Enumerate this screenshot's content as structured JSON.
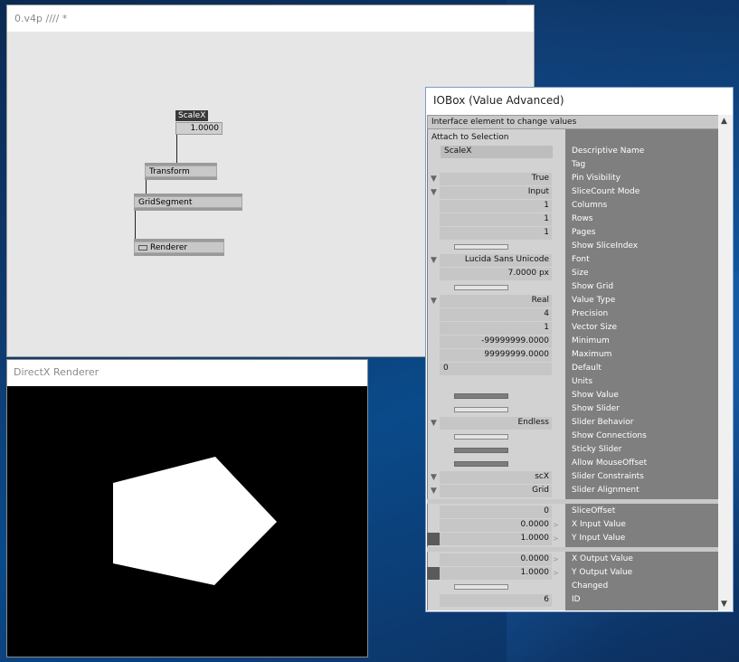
{
  "patch": {
    "title": "0.v4p //// *",
    "scalex_node": "ScaleX",
    "scalex_value": "1.0000",
    "transform_node": "Transform",
    "gridsegment_node": "GridSegment",
    "renderer_node": "Renderer"
  },
  "renderer": {
    "title": "DirectX Renderer"
  },
  "iobox": {
    "title": "IOBox (Value Advanced)",
    "description": "Interface element to change values",
    "attach_label": "Attach to Selection",
    "descriptive_name_value": "ScaleX",
    "rows": [
      {
        "label": "Descriptive Name",
        "value": "",
        "kind": "blank"
      },
      {
        "label": "Tag",
        "value": "",
        "kind": "blank"
      },
      {
        "label": "Pin Visibility",
        "value": "True",
        "kind": "enum"
      },
      {
        "label": "SliceCount Mode",
        "value": "Input",
        "kind": "enum"
      },
      {
        "label": "Columns",
        "value": "1",
        "kind": "num"
      },
      {
        "label": "Rows",
        "value": "1",
        "kind": "num"
      },
      {
        "label": "Pages",
        "value": "1",
        "kind": "num"
      },
      {
        "label": "Show SliceIndex",
        "value": "",
        "kind": "toggle-off"
      },
      {
        "label": "Font",
        "value": "Lucida Sans Unicode",
        "kind": "enum"
      },
      {
        "label": "Size",
        "value": "7.0000 px",
        "kind": "num"
      },
      {
        "label": "Show Grid",
        "value": "",
        "kind": "toggle-off"
      },
      {
        "label": "Value Type",
        "value": "Real",
        "kind": "enum"
      },
      {
        "label": "Precision",
        "value": "4",
        "kind": "num"
      },
      {
        "label": "Vector Size",
        "value": "1",
        "kind": "num"
      },
      {
        "label": "Minimum",
        "value": "-99999999.0000",
        "kind": "num"
      },
      {
        "label": "Maximum",
        "value": "99999999.0000",
        "kind": "num"
      },
      {
        "label": "Default",
        "value": "0",
        "kind": "left"
      },
      {
        "label": "Units",
        "value": "",
        "kind": "blank"
      },
      {
        "label": "Show Value",
        "value": "",
        "kind": "toggle-on"
      },
      {
        "label": "Show Slider",
        "value": "",
        "kind": "toggle-off"
      },
      {
        "label": "Slider Behavior",
        "value": "Endless",
        "kind": "enum"
      },
      {
        "label": "Show Connections",
        "value": "",
        "kind": "toggle-off"
      },
      {
        "label": "Sticky Slider",
        "value": "",
        "kind": "toggle-on"
      },
      {
        "label": "Allow MouseOffset",
        "value": "",
        "kind": "toggle-on"
      },
      {
        "label": "Slider Constraints",
        "value": "scX",
        "kind": "enum"
      },
      {
        "label": "Slider Alignment",
        "value": "Grid",
        "kind": "enum"
      }
    ],
    "rows2": [
      {
        "label": "SliceOffset",
        "value": "0",
        "kind": "num"
      },
      {
        "label": "X Input Value",
        "value": "0.0000",
        "kind": "arrow"
      },
      {
        "label": "Y Input Value",
        "value": "1.0000",
        "kind": "arrow-sw"
      }
    ],
    "rows3": [
      {
        "label": "X Output Value",
        "value": "0.0000",
        "kind": "arrow"
      },
      {
        "label": "Y Output Value",
        "value": "1.0000",
        "kind": "arrow-sw"
      },
      {
        "label": "Changed",
        "value": "",
        "kind": "toggle-off"
      },
      {
        "label": "ID",
        "value": "6",
        "kind": "num"
      }
    ]
  }
}
